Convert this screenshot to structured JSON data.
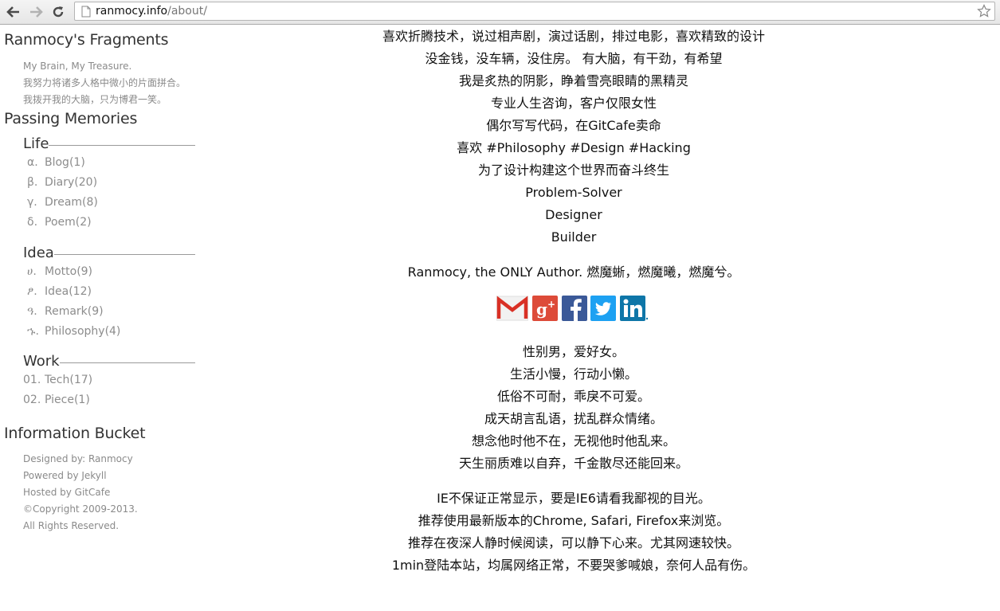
{
  "browser": {
    "url_host": "ranmocy.info",
    "url_path": "/about/"
  },
  "sidebar": {
    "site_title": "Ranmocy's Fragments",
    "taglines": [
      "My Brain, My Treasure.",
      "我努力将诸多人格中微小的片面拼合。",
      "我拨开我的大脑，只为博君一笑。"
    ],
    "memories_title": "Passing Memories",
    "groups": [
      {
        "label": "Life",
        "items": [
          {
            "bullet": "α.",
            "label": "Blog(1)"
          },
          {
            "bullet": "β.",
            "label": "Diary(20)"
          },
          {
            "bullet": "γ.",
            "label": "Dream(8)"
          },
          {
            "bullet": "δ.",
            "label": "Poem(2)"
          }
        ]
      },
      {
        "label": "Idea",
        "items": [
          {
            "bullet": "ሀ.",
            "label": "Motto(9)"
          },
          {
            "bullet": "ፆ.",
            "label": "Idea(12)"
          },
          {
            "bullet": "ዓ.",
            "label": "Remark(9)"
          },
          {
            "bullet": "ኁ.",
            "label": "Philosophy(4)"
          }
        ]
      },
      {
        "label": "Work",
        "items": [
          {
            "bullet": "01.",
            "label": "Tech(17)"
          },
          {
            "bullet": "02.",
            "label": "Piece(1)"
          }
        ]
      }
    ],
    "bucket_title": "Information Bucket",
    "footer": [
      "Designed by: Ranmocy",
      "Powered by Jekyll",
      "Hosted by GitCafe",
      "©Copyright 2009-2013.",
      "All Rights Reserved."
    ]
  },
  "main": {
    "intro_lines": [
      "喜欢折腾技术，说过相声剧，演过话剧，排过电影，喜欢精致的设计",
      "没金钱，没车辆，没住房。 有大脑，有干劲，有希望",
      "我是炙热的阴影，睁着雪亮眼睛的黑精灵",
      "专业人生咨询，客户仅限女性",
      "偶尔写写代码，在GitCafe卖命",
      "喜欢 #Philosophy #Design #Hacking",
      "为了设计构建这个世界而奋斗终生",
      "Problem-Solver",
      "Designer",
      "Builder"
    ],
    "author_line": "Ranmocy, the ONLY Author. 燃魔蜥，燃魔曦，燃魔兮。",
    "social_icons": [
      "gmail-icon",
      "google-plus-icon",
      "facebook-icon",
      "twitter-icon",
      "linkedin-icon"
    ],
    "personal_lines": [
      "性别男，爱好女。",
      "生活小慢，行动小懒。",
      "低俗不可耐，乖戾不可爱。",
      "成天胡言乱语，扰乱群众情绪。",
      "想念他时他不在，无视他时他乱来。",
      "天生丽质难以自弃，千金散尽还能回来。"
    ],
    "notice_lines": [
      "IE不保证正常显示，要是IE6请看我鄙视的目光。",
      "推荐使用最新版本的Chrome, Safari, Firefox来浏览。",
      "推荐在夜深人静时候阅读，可以静下心来。尤其网速较快。",
      "1min登陆本站，均属网络正常，不要哭爹喊娘，奈何人品有伤。"
    ]
  },
  "colors": {
    "gmail_red": "#d93025",
    "gplus_red": "#dd4b39",
    "facebook_blue": "#3b5998",
    "twitter_blue": "#1da1f2",
    "linkedin_blue": "#0e76a8",
    "sidebar_gray": "#8a8a8a"
  }
}
